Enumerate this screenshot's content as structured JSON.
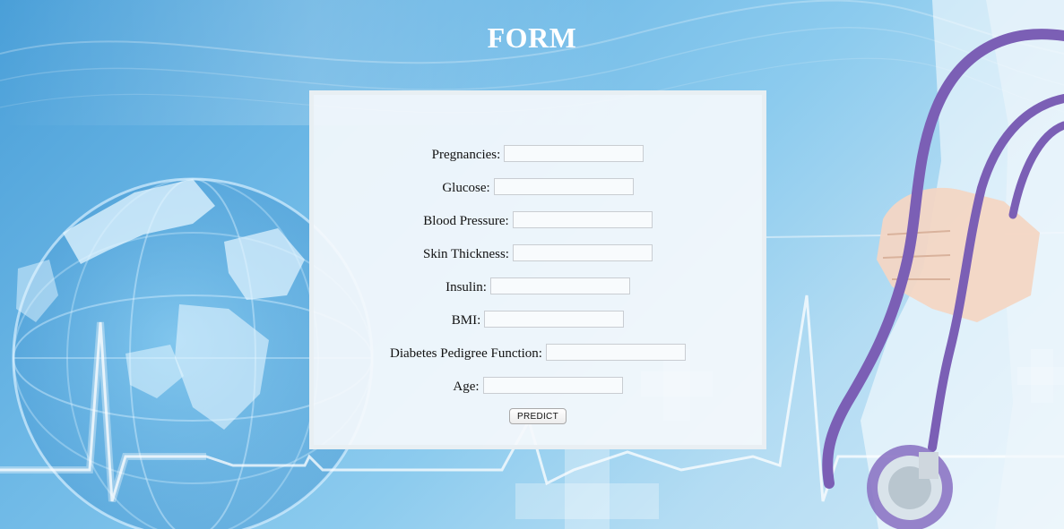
{
  "header": {
    "title": "FORM"
  },
  "form": {
    "fields": [
      {
        "label": "Pregnancies:",
        "value": "",
        "name": "pregnancies"
      },
      {
        "label": "Glucose:",
        "value": "",
        "name": "glucose"
      },
      {
        "label": "Blood Pressure:",
        "value": "",
        "name": "blood-pressure"
      },
      {
        "label": "Skin Thickness:",
        "value": "",
        "name": "skin-thickness"
      },
      {
        "label": "Insulin:",
        "value": "",
        "name": "insulin"
      },
      {
        "label": "BMI:",
        "value": "",
        "name": "bmi"
      },
      {
        "label": "Diabetes Pedigree Function:",
        "value": "",
        "name": "diabetes-pedigree-function"
      },
      {
        "label": "Age:",
        "value": "",
        "name": "age"
      }
    ],
    "submit_label": "PREDICT"
  },
  "colors": {
    "background_primary": "#4a9fd8",
    "background_light": "#cfe8f6",
    "title": "#ffffff",
    "card": "#f5f9fc",
    "stethoscope": "#7b5fb5"
  },
  "background": {
    "icons": [
      "globe-graphic",
      "heartbeat-line",
      "medical-cross",
      "stethoscope",
      "doctor-hands"
    ]
  }
}
